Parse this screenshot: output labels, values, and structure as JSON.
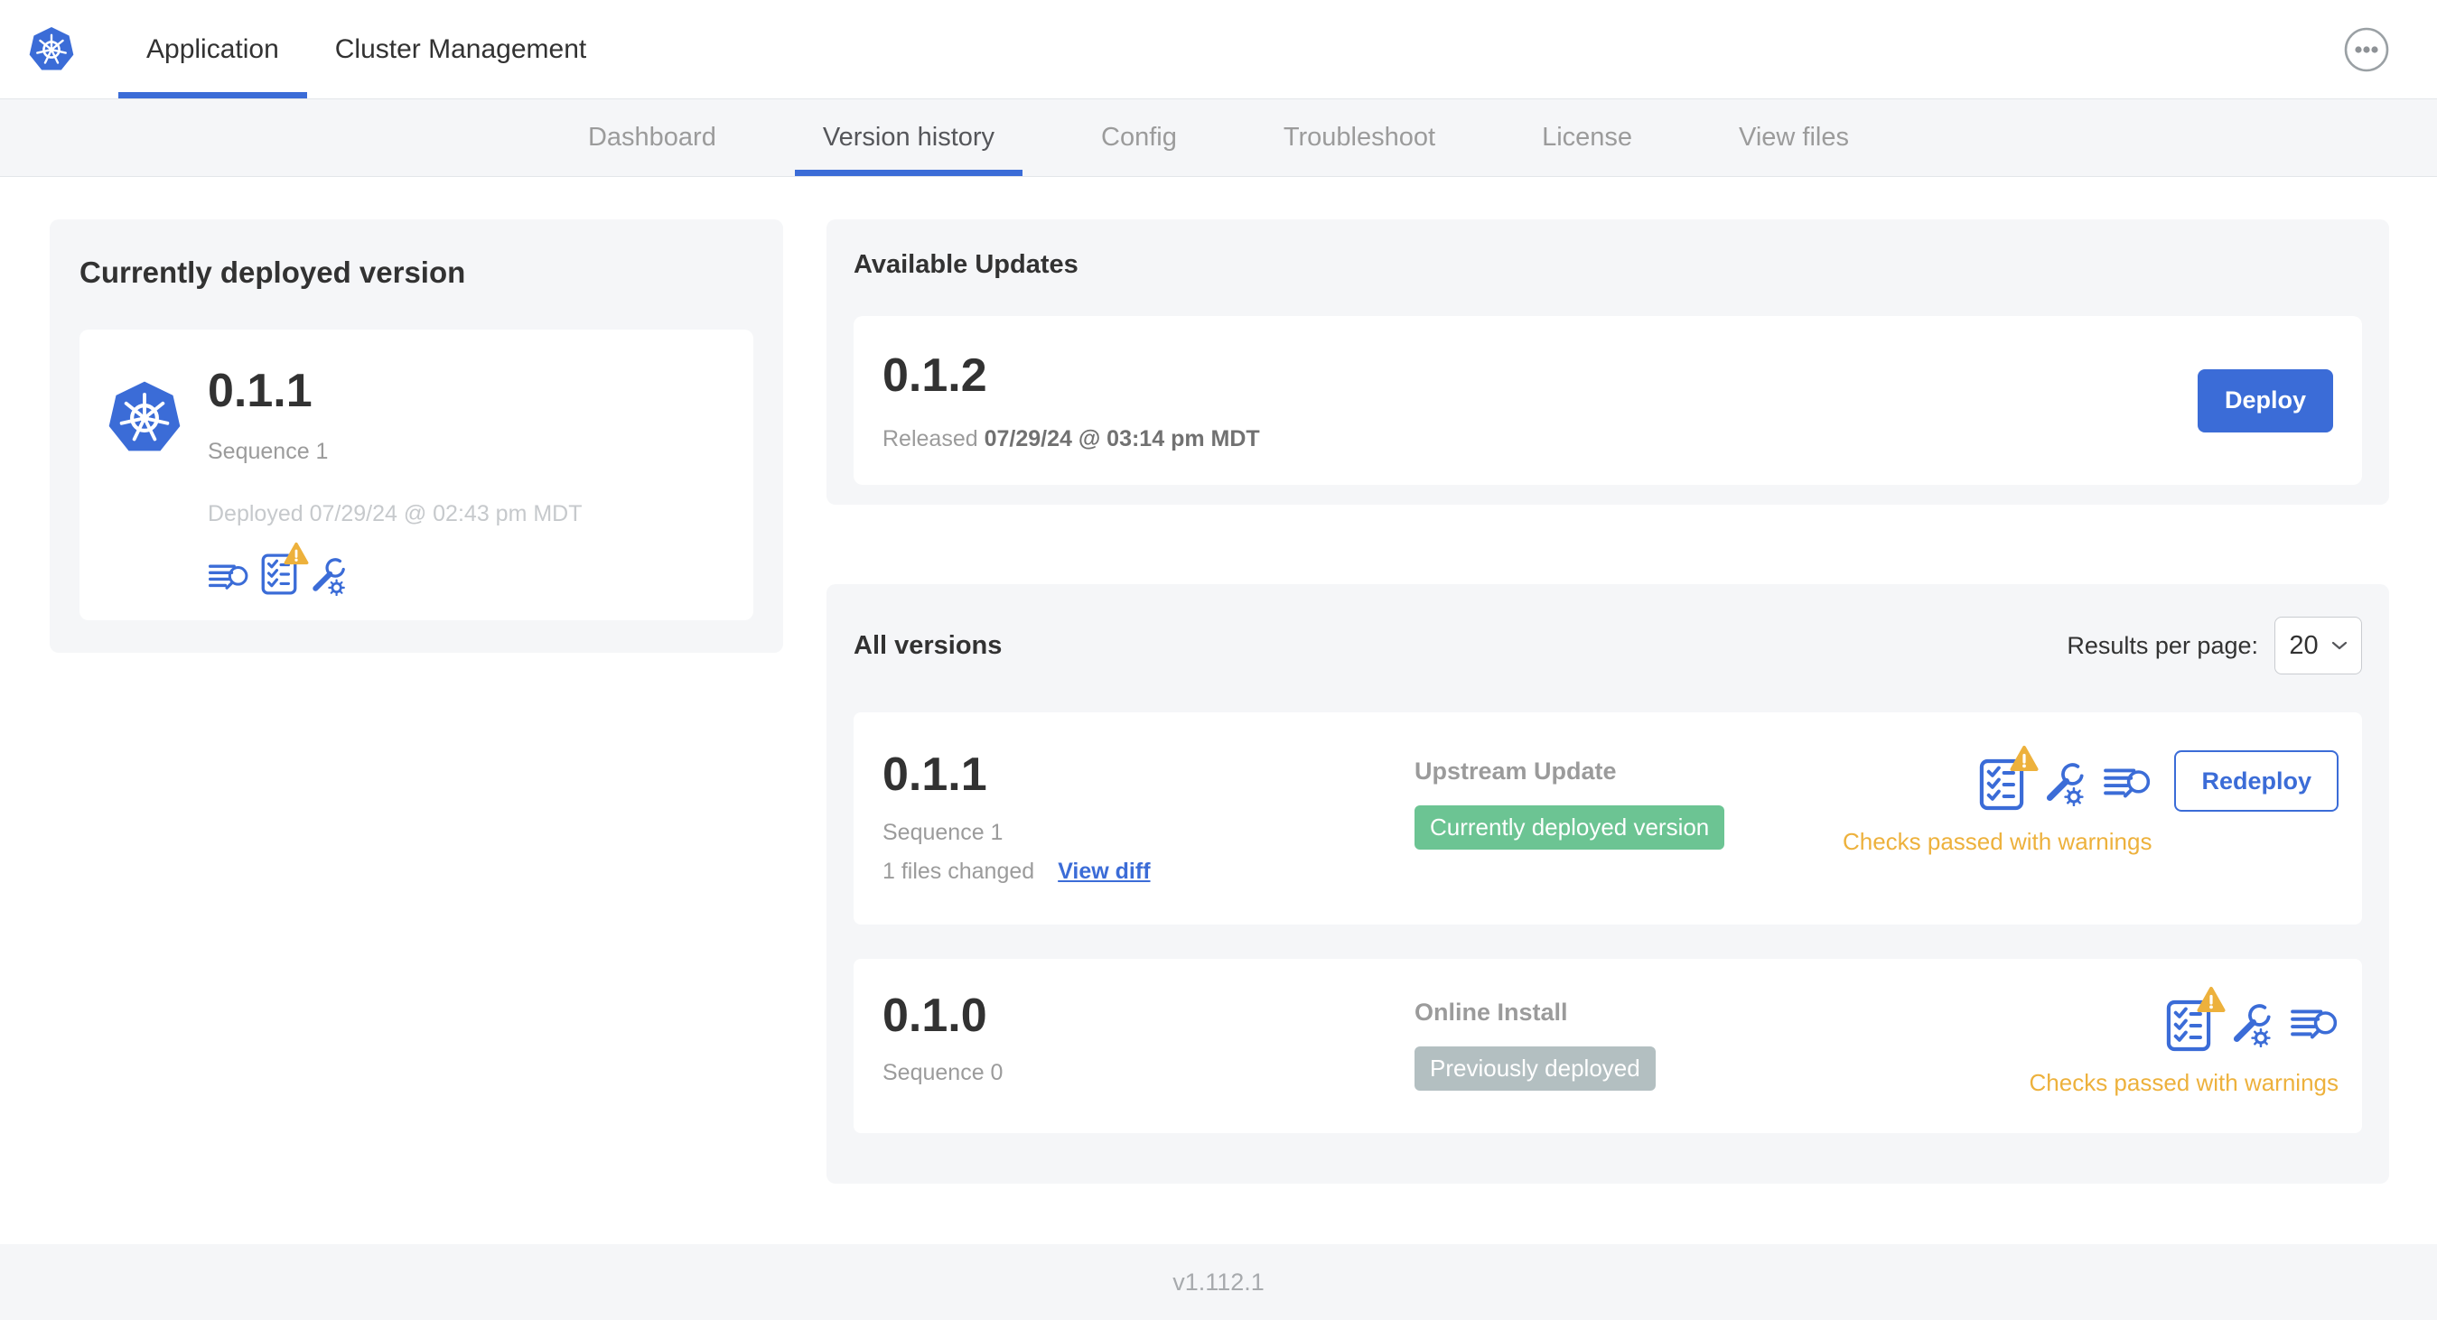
{
  "header": {
    "tabs": [
      {
        "label": "Application",
        "active": true
      },
      {
        "label": "Cluster Management",
        "active": false
      }
    ],
    "overflow_menu_icon": "ellipsis-circle-icon"
  },
  "subnav": {
    "active": "Version history",
    "tabs": [
      {
        "label": "Dashboard"
      },
      {
        "label": "Version history"
      },
      {
        "label": "Config"
      },
      {
        "label": "Troubleshoot"
      },
      {
        "label": "License"
      },
      {
        "label": "View files"
      }
    ]
  },
  "deployed_card": {
    "title": "Currently deployed version",
    "app_icon": "kubernetes-logo-icon",
    "version": "0.1.1",
    "sequence": "Sequence 1",
    "deployed_at": "Deployed 07/29/24 @ 02:43 pm MDT",
    "icons": [
      "release-notes-icon",
      "preflight-checks-warning-icon",
      "config-icon"
    ]
  },
  "available_updates": {
    "title": "Available Updates",
    "version": "0.1.2",
    "released_label": "Released",
    "released_at": "07/29/24 @ 03:14 pm MDT",
    "deploy_label": "Deploy"
  },
  "all_versions": {
    "title": "All versions",
    "results_per_page_label": "Results per page:",
    "results_per_page_value": "20",
    "rows": [
      {
        "version": "0.1.1",
        "sequence": "Sequence 1",
        "files_changed": "1 files changed",
        "view_diff_label": "View diff",
        "source": "Upstream Update",
        "badge": "Currently deployed version",
        "badge_color": "green",
        "icons": [
          "preflight-checks-warning-icon",
          "config-icon",
          "release-notes-icon"
        ],
        "checks": "Checks passed with warnings",
        "action_label": "Redeploy"
      },
      {
        "version": "0.1.0",
        "sequence": "Sequence 0",
        "source": "Online Install",
        "badge": "Previously deployed",
        "badge_color": "gray",
        "icons": [
          "preflight-checks-warning-icon",
          "config-icon",
          "release-notes-icon"
        ],
        "checks": "Checks passed with warnings"
      }
    ]
  },
  "footer": {
    "version": "v1.112.1"
  },
  "colors": {
    "primary_blue": "#3b6cd7",
    "success_green": "#6cc493",
    "muted_badge_gray": "#b3bfc1",
    "warning_amber": "#edb13c",
    "panel_gray": "#f5f6f8"
  }
}
